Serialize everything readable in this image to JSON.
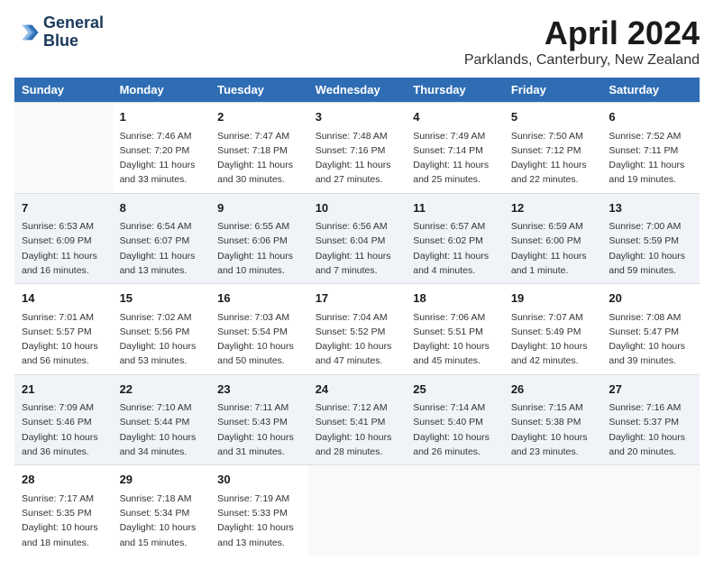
{
  "header": {
    "logo_line1": "General",
    "logo_line2": "Blue",
    "month": "April 2024",
    "location": "Parklands, Canterbury, New Zealand"
  },
  "days_header": [
    "Sunday",
    "Monday",
    "Tuesday",
    "Wednesday",
    "Thursday",
    "Friday",
    "Saturday"
  ],
  "weeks": [
    [
      {
        "day": "",
        "detail": ""
      },
      {
        "day": "1",
        "detail": "Sunrise: 7:46 AM\nSunset: 7:20 PM\nDaylight: 11 hours\nand 33 minutes."
      },
      {
        "day": "2",
        "detail": "Sunrise: 7:47 AM\nSunset: 7:18 PM\nDaylight: 11 hours\nand 30 minutes."
      },
      {
        "day": "3",
        "detail": "Sunrise: 7:48 AM\nSunset: 7:16 PM\nDaylight: 11 hours\nand 27 minutes."
      },
      {
        "day": "4",
        "detail": "Sunrise: 7:49 AM\nSunset: 7:14 PM\nDaylight: 11 hours\nand 25 minutes."
      },
      {
        "day": "5",
        "detail": "Sunrise: 7:50 AM\nSunset: 7:12 PM\nDaylight: 11 hours\nand 22 minutes."
      },
      {
        "day": "6",
        "detail": "Sunrise: 7:52 AM\nSunset: 7:11 PM\nDaylight: 11 hours\nand 19 minutes."
      }
    ],
    [
      {
        "day": "7",
        "detail": "Sunrise: 6:53 AM\nSunset: 6:09 PM\nDaylight: 11 hours\nand 16 minutes."
      },
      {
        "day": "8",
        "detail": "Sunrise: 6:54 AM\nSunset: 6:07 PM\nDaylight: 11 hours\nand 13 minutes."
      },
      {
        "day": "9",
        "detail": "Sunrise: 6:55 AM\nSunset: 6:06 PM\nDaylight: 11 hours\nand 10 minutes."
      },
      {
        "day": "10",
        "detail": "Sunrise: 6:56 AM\nSunset: 6:04 PM\nDaylight: 11 hours\nand 7 minutes."
      },
      {
        "day": "11",
        "detail": "Sunrise: 6:57 AM\nSunset: 6:02 PM\nDaylight: 11 hours\nand 4 minutes."
      },
      {
        "day": "12",
        "detail": "Sunrise: 6:59 AM\nSunset: 6:00 PM\nDaylight: 11 hours\nand 1 minute."
      },
      {
        "day": "13",
        "detail": "Sunrise: 7:00 AM\nSunset: 5:59 PM\nDaylight: 10 hours\nand 59 minutes."
      }
    ],
    [
      {
        "day": "14",
        "detail": "Sunrise: 7:01 AM\nSunset: 5:57 PM\nDaylight: 10 hours\nand 56 minutes."
      },
      {
        "day": "15",
        "detail": "Sunrise: 7:02 AM\nSunset: 5:56 PM\nDaylight: 10 hours\nand 53 minutes."
      },
      {
        "day": "16",
        "detail": "Sunrise: 7:03 AM\nSunset: 5:54 PM\nDaylight: 10 hours\nand 50 minutes."
      },
      {
        "day": "17",
        "detail": "Sunrise: 7:04 AM\nSunset: 5:52 PM\nDaylight: 10 hours\nand 47 minutes."
      },
      {
        "day": "18",
        "detail": "Sunrise: 7:06 AM\nSunset: 5:51 PM\nDaylight: 10 hours\nand 45 minutes."
      },
      {
        "day": "19",
        "detail": "Sunrise: 7:07 AM\nSunset: 5:49 PM\nDaylight: 10 hours\nand 42 minutes."
      },
      {
        "day": "20",
        "detail": "Sunrise: 7:08 AM\nSunset: 5:47 PM\nDaylight: 10 hours\nand 39 minutes."
      }
    ],
    [
      {
        "day": "21",
        "detail": "Sunrise: 7:09 AM\nSunset: 5:46 PM\nDaylight: 10 hours\nand 36 minutes."
      },
      {
        "day": "22",
        "detail": "Sunrise: 7:10 AM\nSunset: 5:44 PM\nDaylight: 10 hours\nand 34 minutes."
      },
      {
        "day": "23",
        "detail": "Sunrise: 7:11 AM\nSunset: 5:43 PM\nDaylight: 10 hours\nand 31 minutes."
      },
      {
        "day": "24",
        "detail": "Sunrise: 7:12 AM\nSunset: 5:41 PM\nDaylight: 10 hours\nand 28 minutes."
      },
      {
        "day": "25",
        "detail": "Sunrise: 7:14 AM\nSunset: 5:40 PM\nDaylight: 10 hours\nand 26 minutes."
      },
      {
        "day": "26",
        "detail": "Sunrise: 7:15 AM\nSunset: 5:38 PM\nDaylight: 10 hours\nand 23 minutes."
      },
      {
        "day": "27",
        "detail": "Sunrise: 7:16 AM\nSunset: 5:37 PM\nDaylight: 10 hours\nand 20 minutes."
      }
    ],
    [
      {
        "day": "28",
        "detail": "Sunrise: 7:17 AM\nSunset: 5:35 PM\nDaylight: 10 hours\nand 18 minutes."
      },
      {
        "day": "29",
        "detail": "Sunrise: 7:18 AM\nSunset: 5:34 PM\nDaylight: 10 hours\nand 15 minutes."
      },
      {
        "day": "30",
        "detail": "Sunrise: 7:19 AM\nSunset: 5:33 PM\nDaylight: 10 hours\nand 13 minutes."
      },
      {
        "day": "",
        "detail": ""
      },
      {
        "day": "",
        "detail": ""
      },
      {
        "day": "",
        "detail": ""
      },
      {
        "day": "",
        "detail": ""
      }
    ]
  ]
}
